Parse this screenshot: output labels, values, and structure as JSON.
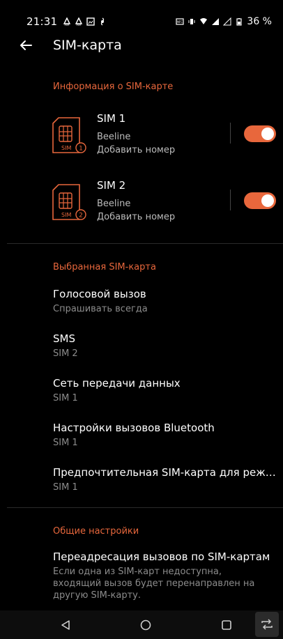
{
  "status_bar": {
    "time": "21:31",
    "battery_text": "36 %",
    "icons": [
      "adaptive-icon",
      "adaptive-icon",
      "image-icon",
      "fan-icon",
      "nfc-icon",
      "vibrate-icon",
      "wifi-icon",
      "signal-icon",
      "signal-icon",
      "battery-icon"
    ]
  },
  "app_bar": {
    "title": "SIM-карта",
    "back_icon": "arrow-back-icon"
  },
  "sections": {
    "sim_info": "Информация о SIM-карте",
    "preferred_sim": "Выбранная SIM-карта",
    "general": "Общие настройки"
  },
  "sims": [
    {
      "name": "SIM 1",
      "operator": "Beeline",
      "action": "Добавить номер",
      "badge_label": "SIM",
      "badge_number": "1",
      "enabled": true
    },
    {
      "name": "SIM 2",
      "operator": "Beeline",
      "action": "Добавить номер",
      "badge_label": "SIM",
      "badge_number": "2",
      "enabled": true
    }
  ],
  "preferences": [
    {
      "title": "Голосовой вызов",
      "subtitle": "Спрашивать всегда"
    },
    {
      "title": "SMS",
      "subtitle": "SIM 2"
    },
    {
      "title": "Сеть передачи данных",
      "subtitle": "SIM 1"
    },
    {
      "title": "Настройки вызовов Bluetooth",
      "subtitle": "SIM 1"
    },
    {
      "title": "Предпочтительная SIM-карта для режима..",
      "subtitle": "SIM 1"
    }
  ],
  "general": {
    "title": "Переадресация вызовов по SIM-картам",
    "description": "Если одна из SIM-карт недоступна, входящий вызов будет перенаправлен на другую SIM-карту."
  },
  "colors": {
    "accent": "#e8673c",
    "background": "#000000",
    "secondary_text": "#8c8c8c"
  },
  "nav_bar": {
    "buttons": [
      "back-triangle-icon",
      "home-circle-icon",
      "recents-square-icon",
      "screen-rotate-icon"
    ]
  }
}
